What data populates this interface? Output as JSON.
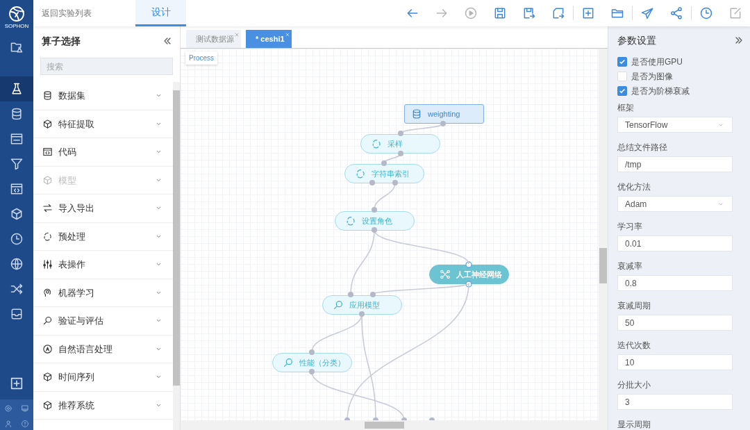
{
  "app": {
    "logo_text": "SOPHON"
  },
  "rail": {
    "items": [
      {
        "selected": false
      },
      {
        "selected": true
      },
      {
        "selected": false
      },
      {
        "selected": false
      },
      {
        "selected": false
      },
      {
        "selected": false
      },
      {
        "selected": false
      },
      {
        "selected": false
      },
      {
        "selected": false
      },
      {
        "selected": false
      },
      {
        "selected": false
      }
    ]
  },
  "topbar": {
    "back_link": "返回实验列表",
    "tabs": [
      {
        "label": "设计",
        "selected": true
      }
    ],
    "toolbar": [
      {
        "disabled": false
      },
      {
        "disabled": true
      },
      {
        "disabled": true
      },
      {
        "disabled": false
      },
      {
        "disabled": false
      },
      {
        "disabled": false
      },
      {
        "disabled": false
      },
      {
        "disabled": false
      },
      {
        "disabled": false
      },
      {
        "disabled": false
      },
      {
        "disabled": false
      },
      {
        "disabled": true
      }
    ]
  },
  "operator_panel": {
    "title": "算子选择",
    "search": {
      "placeholder": "搜索"
    },
    "items": [
      {
        "label": "数据集",
        "disabled": false
      },
      {
        "label": "特征提取",
        "disabled": false
      },
      {
        "label": "代码",
        "disabled": false
      },
      {
        "label": "模型",
        "disabled": true
      },
      {
        "label": "导入导出",
        "disabled": false
      },
      {
        "label": "预处理",
        "disabled": false
      },
      {
        "label": "表操作",
        "disabled": false
      },
      {
        "label": "机器学习",
        "disabled": false
      },
      {
        "label": "验证与评估",
        "disabled": false
      },
      {
        "label": "自然语言处理",
        "disabled": false
      },
      {
        "label": "时间序列",
        "disabled": false
      },
      {
        "label": "推荐系统",
        "disabled": false
      }
    ]
  },
  "canvas": {
    "tabs": [
      {
        "label": "测试数据源",
        "selected": false
      },
      {
        "label": "* ceshi1",
        "selected": true
      }
    ],
    "breadcrumb": "Process",
    "nodes": [
      {
        "kind": "dataset",
        "label": "weighting",
        "selected": false
      },
      {
        "kind": "preprocess",
        "label": "采样",
        "selected": false
      },
      {
        "kind": "preprocess",
        "label": "字符串索引",
        "selected": false
      },
      {
        "kind": "preprocess",
        "label": "设置角色",
        "selected": false
      },
      {
        "kind": "network",
        "label": "人工神经网络",
        "selected": true
      },
      {
        "kind": "evaluate",
        "label": "应用模型",
        "selected": false
      },
      {
        "kind": "evaluate",
        "label": "性能（分类）",
        "selected": false
      }
    ]
  },
  "params": {
    "title": "参数设置",
    "checkboxes": [
      {
        "label": "是否使用GPU",
        "checked": true
      },
      {
        "label": "是否为图像",
        "checked": false
      },
      {
        "label": "是否为阶梯衰减",
        "checked": true
      }
    ],
    "fields": [
      {
        "kind": "select",
        "label": "框架",
        "value": "TensorFlow"
      },
      {
        "kind": "text",
        "label": "总结文件路径",
        "value": "/tmp"
      },
      {
        "kind": "select",
        "label": "优化方法",
        "value": "Adam"
      },
      {
        "kind": "text",
        "label": "学习率",
        "value": "0.01"
      },
      {
        "kind": "text",
        "label": "衰减率",
        "value": "0.8"
      },
      {
        "kind": "text",
        "label": "衰减周期",
        "value": "50"
      },
      {
        "kind": "text",
        "label": "迭代次数",
        "value": "10"
      },
      {
        "kind": "text",
        "label": "分批大小",
        "value": "3"
      },
      {
        "label": "显示周期"
      }
    ]
  }
}
